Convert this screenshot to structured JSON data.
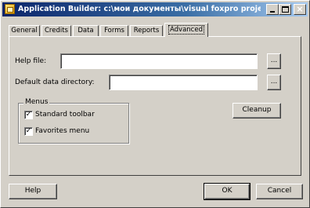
{
  "window": {
    "title": "Application Builder: c:\\мои документы\\visual foxpro projects\\bo...",
    "icon": "app-builder-icon"
  },
  "tabs": [
    {
      "label": "General"
    },
    {
      "label": "Credits"
    },
    {
      "label": "Data"
    },
    {
      "label": "Forms"
    },
    {
      "label": "Reports"
    },
    {
      "label": "Advanced"
    }
  ],
  "active_tab": "Advanced",
  "advanced": {
    "help_file_label": "Help file:",
    "help_file_value": "",
    "browse_label": "...",
    "data_dir_label": "Default data directory:",
    "data_dir_value": "",
    "menus_group_label": "Menus",
    "standard_toolbar_label": "Standard toolbar",
    "standard_toolbar_checked": true,
    "favorites_menu_label": "Favorites menu",
    "favorites_menu_checked": true,
    "cleanup_label": "Cleanup"
  },
  "footer": {
    "help_label": "Help",
    "ok_label": "OK",
    "cancel_label": "Cancel"
  },
  "colors": {
    "face": "#d4d0c8",
    "title_start": "#0a246a",
    "title_end": "#a6caf0"
  }
}
